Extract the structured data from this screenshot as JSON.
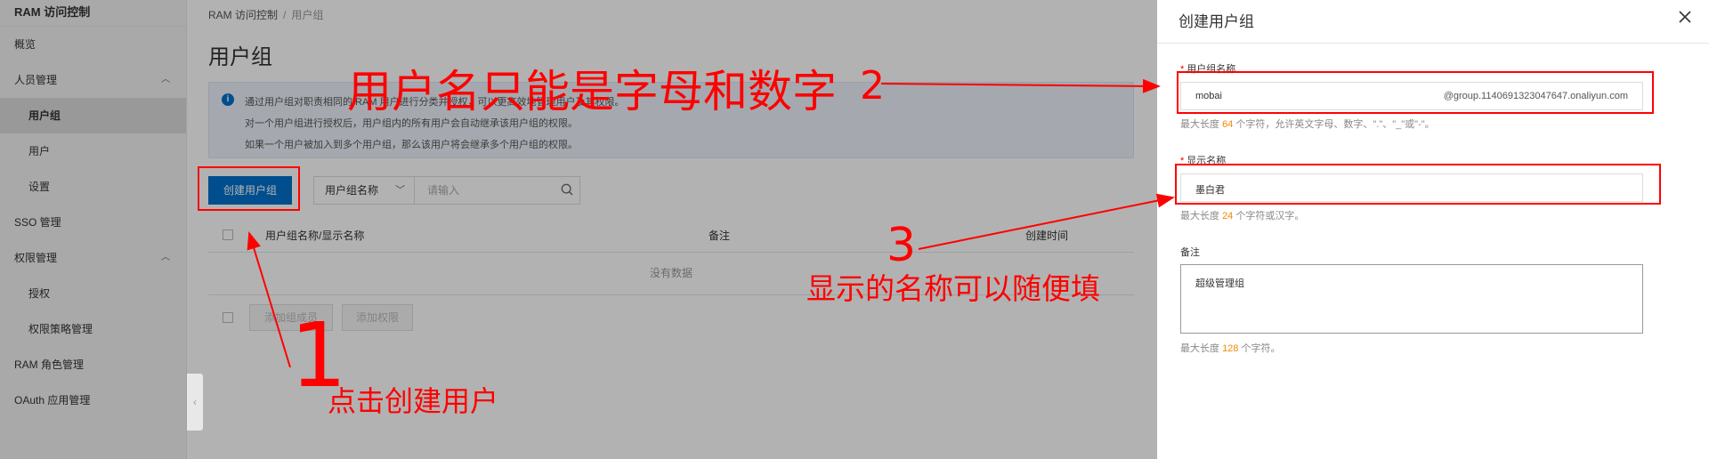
{
  "sidebar": {
    "brand": "RAM 访问控制",
    "items": [
      {
        "label": "概览"
      },
      {
        "label": "人员管理"
      },
      {
        "label": "用户组"
      },
      {
        "label": "用户"
      },
      {
        "label": "设置"
      },
      {
        "label": "SSO 管理"
      },
      {
        "label": "权限管理"
      },
      {
        "label": "授权"
      },
      {
        "label": "权限策略管理"
      },
      {
        "label": "RAM 角色管理"
      },
      {
        "label": "OAuth 应用管理"
      }
    ]
  },
  "breadcrumb": {
    "root": "RAM 访问控制",
    "sep": "/",
    "current": "用户组"
  },
  "page": {
    "title": "用户组",
    "info_lines": [
      "通过用户组对职责相同的 RAM 用户进行分类并授权，可以更高效地管理用户及其权限。",
      "对一个用户组进行授权后，用户组内的所有用户会自动继承该用户组的权限。",
      "如果一个用户被加入到多个用户组，那么该用户将会继承多个用户组的权限。"
    ],
    "info_icon": "i",
    "create_button": "创建用户组",
    "filter_select": "用户组名称",
    "search_placeholder": "请输入",
    "table_headers": [
      "用户组名称/显示名称",
      "备注",
      "创建时间"
    ],
    "empty_text": "没有数据",
    "footer_buttons": [
      "添加组成员",
      "添加权限"
    ]
  },
  "drawer": {
    "title": "创建用户组",
    "fields": {
      "group_name_label": "用户组名称",
      "group_name_value": "mobai",
      "group_name_suffix": "@group.1140691323047647.onaliyun.com",
      "group_name_hint_pre": "最大长度",
      "group_name_hint_num": "64",
      "group_name_hint_post": "个字符，允许英文字母、数字、\".\"、\"_\"或\"-\"。",
      "display_name_label": "显示名称",
      "display_name_value": "墨白君",
      "display_name_hint_pre": "最大长度",
      "display_name_hint_num": "24",
      "display_name_hint_post": "个字符或汉字。",
      "remark_label": "备注",
      "remark_value": "超级管理组",
      "remark_hint_pre": "最大长度",
      "remark_hint_num": "128",
      "remark_hint_post": "个字符。"
    }
  },
  "annotations": {
    "big_1": "1",
    "text_1": "点击创建用户",
    "text_2": "用户名只能是字母和数字",
    "num_2": "2",
    "num_3": "3",
    "text_3": "显示的名称可以随便填"
  },
  "colors": {
    "accent": "#0070cc",
    "annotation": "#ff0000",
    "hint_number": "#f08a00"
  }
}
